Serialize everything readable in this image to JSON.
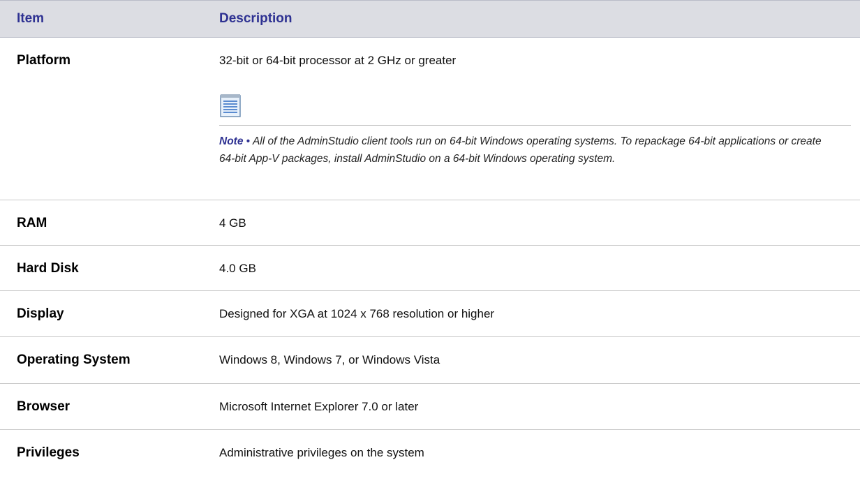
{
  "header": {
    "item": "Item",
    "description": "Description"
  },
  "rows": [
    {
      "item": "Platform",
      "description": "32-bit or 64-bit processor at 2 GHz or greater",
      "note": {
        "label": "Note",
        "bullet": "•",
        "text": "All of the AdminStudio client tools run on 64-bit Windows operating systems. To repackage 64-bit applications or create 64-bit App-V packages, install AdminStudio on a 64-bit Windows operating system.",
        "icon": "note-icon"
      }
    },
    {
      "item": "RAM",
      "description": "4 GB"
    },
    {
      "item": "Hard Disk",
      "description": "4.0 GB"
    },
    {
      "item": "Display",
      "description": "Designed for XGA at 1024 x 768 resolution or higher"
    },
    {
      "item": "Operating System",
      "description": "Windows 8, Windows 7, or Windows Vista"
    },
    {
      "item": "Browser",
      "description": "Microsoft Internet Explorer 7.0 or later"
    },
    {
      "item": "Privileges",
      "description": "Administrative privileges on the system"
    }
  ],
  "colors": {
    "header_bg": "#dcdde3",
    "header_text": "#2e3192",
    "note_accent": "#2e3192"
  }
}
